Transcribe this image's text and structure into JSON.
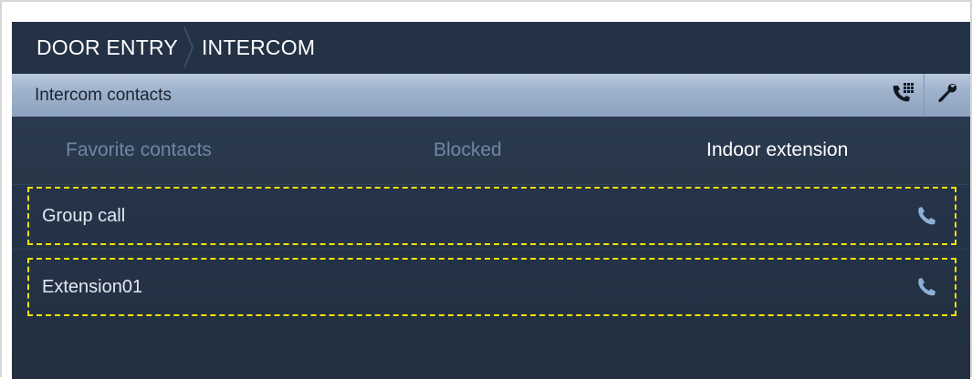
{
  "breadcrumb": {
    "items": [
      "DOOR ENTRY",
      "INTERCOM"
    ]
  },
  "header": {
    "title": "Intercom contacts",
    "keypad_icon": "phone-keypad-icon",
    "settings_icon": "wrench-icon"
  },
  "tabs": [
    {
      "label": "Favorite contacts",
      "active": false
    },
    {
      "label": "Blocked",
      "active": false
    },
    {
      "label": "Indoor extension",
      "active": true
    }
  ],
  "contacts": [
    {
      "label": "Group call",
      "icon": "phone-icon"
    },
    {
      "label": "Extension01",
      "icon": "phone-icon"
    }
  ],
  "colors": {
    "accent_highlight": "#f2e300",
    "header_bar": "#a3b6cf",
    "background": "#26354a",
    "active_tab_text": "#ffffff",
    "inactive_tab_text": "#6f86a5",
    "call_icon": "#8fb0d6"
  }
}
